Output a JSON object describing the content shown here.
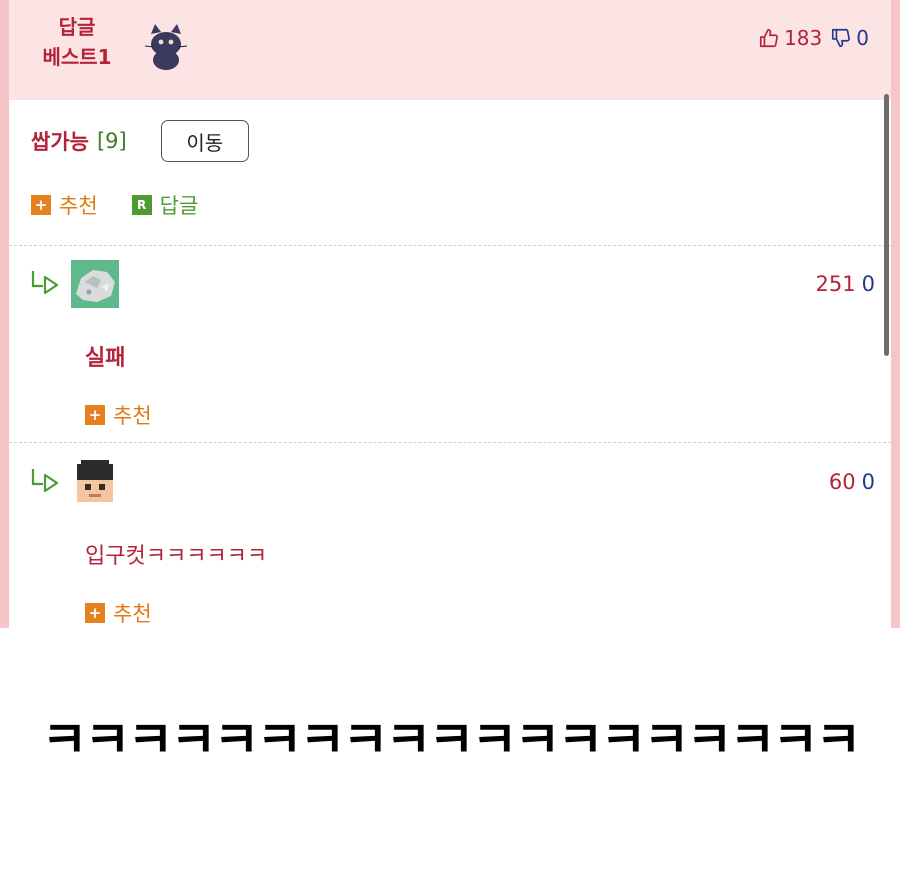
{
  "best": {
    "label_line1": "답글",
    "label_line2": "베스트1",
    "up_count": "183",
    "down_count": "0"
  },
  "post": {
    "nickname": "쌉가능",
    "reply_count": "[9]",
    "move_button": "이동",
    "recommend_label": "추천",
    "reply_label": "답글",
    "recommend_badge": "+",
    "reply_badge": "R"
  },
  "replies": [
    {
      "up": "251",
      "down": "0",
      "text": "실패",
      "recommend_label": "추천"
    },
    {
      "up": "60",
      "down": "0",
      "text": "입구컷ㅋㅋㅋㅋㅋㅋ",
      "recommend_label": "추천"
    }
  ],
  "caption": "ㅋㅋㅋㅋㅋㅋㅋㅋㅋㅋㅋㅋㅋㅋㅋㅋㅋㅋㅋ",
  "colors": {
    "frame": "#f6c5c8",
    "header_bg": "#fce3e4",
    "accent_red": "#b3243a",
    "accent_blue": "#1f3a8c",
    "recommend_orange": "#e07a12",
    "reply_green": "#4e9b36"
  }
}
